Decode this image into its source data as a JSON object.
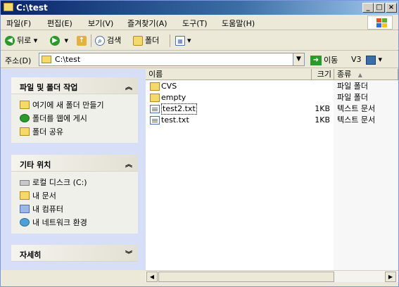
{
  "window": {
    "title": "C:\\test"
  },
  "title_buttons": {
    "minimize": "_",
    "maximize": "□",
    "close": "×"
  },
  "menu": [
    "파일(F)",
    "편집(E)",
    "보기(V)",
    "즐겨찾기(A)",
    "도구(T)",
    "도움말(H)"
  ],
  "toolbar": {
    "back": "뒤로",
    "search": "검색",
    "folders": "폴더"
  },
  "address": {
    "label": "주소(D)",
    "value": "C:\\test",
    "go": "이동",
    "extra": "V3"
  },
  "tasks": {
    "file_folder": {
      "title": "파일 및 폴더 작업",
      "items": [
        "여기에 새 폴더 만들기",
        "폴더를 웹에 게시",
        "폴더 공유"
      ]
    },
    "other_places": {
      "title": "기타 위치",
      "items": [
        "로컬 디스크 (C:)",
        "내 문서",
        "내 컴퓨터",
        "내 네트워크 환경"
      ]
    },
    "details": {
      "title": "자세히"
    }
  },
  "columns": {
    "name": "이름",
    "size": "크기",
    "type": "종류"
  },
  "files": [
    {
      "name": "CVS",
      "size": "",
      "type": "파일 폴더",
      "icon": "folder-icon"
    },
    {
      "name": "empty",
      "size": "",
      "type": "파일 폴더",
      "icon": "folder-icon"
    },
    {
      "name": "test2.txt",
      "size": "1KB",
      "type": "텍스트 문서",
      "icon": "text-file-icon"
    },
    {
      "name": "test.txt",
      "size": "1KB",
      "type": "텍스트 문서",
      "icon": "text-file-icon"
    }
  ]
}
